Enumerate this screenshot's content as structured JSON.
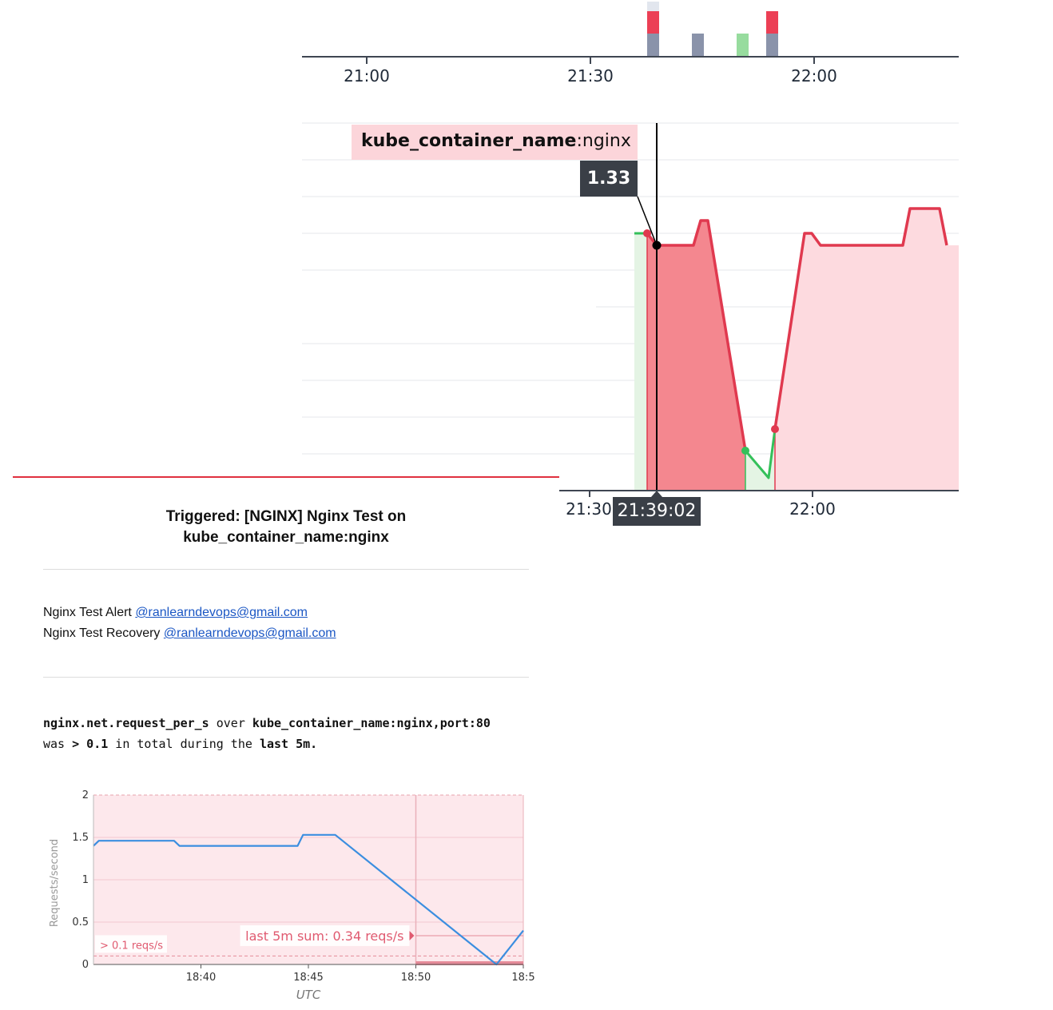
{
  "top_timeline": {
    "ticks": [
      "21:00",
      "21:30",
      "22:00"
    ],
    "colors": {
      "gray": "#8a93aa",
      "red": "#ec3f55",
      "green": "#97dc9e",
      "light": "#e2e6ee"
    }
  },
  "main_chart": {
    "tooltip": {
      "tag_key": "kube_container_name",
      "tag_sep": ":",
      "tag_value": "nginx"
    },
    "hover_value": "1.33",
    "hover_time": "21:39:02",
    "x_ticks": [
      "21:30",
      "22:00"
    ],
    "colors": {
      "alert": "#e0394f",
      "alert_fill_dark": "#f4878f",
      "alert_fill_light": "#fddadf",
      "ok": "#34c05a",
      "ok_fill": "#e4f4e4"
    }
  },
  "email": {
    "title_line1": "Triggered: [NGINX] Nginx Test on",
    "title_line2": "kube_container_name:nginx",
    "notifications": [
      {
        "label": "Nginx Test Alert ",
        "address": "@ranlearndevops@gmail.com"
      },
      {
        "label": "Nginx Test Recovery ",
        "address": "@ranlearndevops@gmail.com"
      }
    ],
    "query": {
      "metric": "nginx.net.request_per_s",
      "over": " over ",
      "scope": "kube_container_name:nginx,port:80",
      "was": "was ",
      "threshold": "> 0.1",
      "in_total": " in total during the ",
      "window": "last 5m."
    }
  },
  "chart_data": {
    "type": "line",
    "title": "",
    "xlabel": "UTC",
    "ylabel": "Requests/second",
    "ylim": [
      0,
      2
    ],
    "y_ticks": [
      "0",
      "0.5",
      "1",
      "1.5",
      "2"
    ],
    "x_ticks": [
      "18:40",
      "18:45",
      "18:50",
      "18:5"
    ],
    "x_domain_minutes": [
      "18:35",
      "18:55"
    ],
    "series": [
      {
        "points": [
          [
            "18:35:00",
            1.4
          ],
          [
            "18:35:15",
            1.46
          ],
          [
            "18:38:45",
            1.46
          ],
          [
            "18:39:00",
            1.4
          ],
          [
            "18:44:30",
            1.4
          ],
          [
            "18:44:45",
            1.53
          ],
          [
            "18:46:15",
            1.53
          ],
          [
            "18:53:45",
            0.0
          ],
          [
            "18:55:00",
            0.4
          ]
        ]
      }
    ],
    "threshold": {
      "value": 0.1,
      "label": "> 0.1 reqs/s"
    },
    "window_label": "last 5m sum: 0.34 reqs/s",
    "window_start": "18:50",
    "colors": {
      "line": "#3b8ee0",
      "bg": "#fde8ec",
      "threshold": "#e58a98",
      "label": "#e05a70"
    }
  }
}
